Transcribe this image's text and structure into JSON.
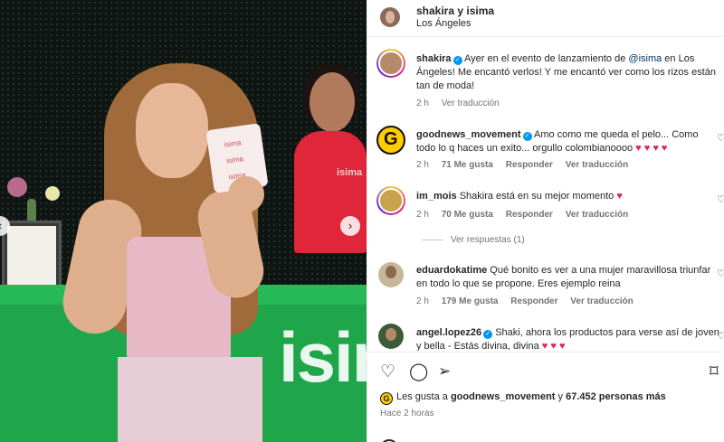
{
  "photo": {
    "counter_brand": "isima",
    "staff_logo": "isima",
    "product_marks": [
      "isima",
      "isima",
      "isima"
    ],
    "nav_prev_icon": "chevron-left-icon",
    "nav_next_icon": "chevron-right-icon"
  },
  "header": {
    "title": "shakira y isima",
    "location": "Los Ángeles"
  },
  "caption": {
    "user": "shakira",
    "text_before_mention": " Ayer en el evento de lanzamiento de ",
    "mention": "@isima",
    "text_after_mention": " en Los Ángeles! Me encantó verlos! Y me encantó ver como los rizos están tan de moda!",
    "time": "2 h",
    "translate": "Ver traducción"
  },
  "comments": [
    {
      "user": "goodnews_movement",
      "verified": true,
      "text": " Amo como me queda el pelo... Como todo lo q haces un exito... orgullo colombianoooo ",
      "emoji": "♥ ♥ ♥ ♥",
      "time": "2 h",
      "likes": "71 Me gusta",
      "reply": "Responder",
      "translate": "Ver traducción"
    },
    {
      "user": "im_mois",
      "verified": false,
      "text": " Shakira está en su mejor momento ",
      "emoji": "♥",
      "time": "2 h",
      "likes": "70 Me gusta",
      "reply": "Responder",
      "translate": "Ver traducción",
      "view_replies": "Ver respuestas (1)"
    },
    {
      "user": "eduardokatime",
      "verified": false,
      "text": " Qué bonito es ver a una mujer maravillosa triunfar en todo lo que se propone. Eres ejemplo reina",
      "emoji": "",
      "time": "2 h",
      "likes": "179 Me gusta",
      "reply": "Responder",
      "translate": "Ver traducción"
    },
    {
      "user": "angel.lopez26",
      "verified": true,
      "text": " Shaki, ahora los productos para verse así de joven y bella - Estás divina, divina ",
      "emoji": "♥ ♥ ♥",
      "time": "",
      "likes": "",
      "reply": "",
      "translate": ""
    }
  ],
  "actions": {
    "like_icon": "heart-icon",
    "comment_icon": "comment-icon",
    "share_icon": "share-icon",
    "save_icon": "bookmark-icon",
    "liked_by_prefix": "Les gusta a ",
    "liked_by_user": "goodnews_movement",
    "liked_by_suffix": " y ",
    "liked_by_count": "67.452 personas más",
    "posted_time": "Hace 2 horas"
  },
  "colors": {
    "accent": "#0095f6",
    "heart": "#e0245e",
    "counter_green": "#1fa64a"
  }
}
